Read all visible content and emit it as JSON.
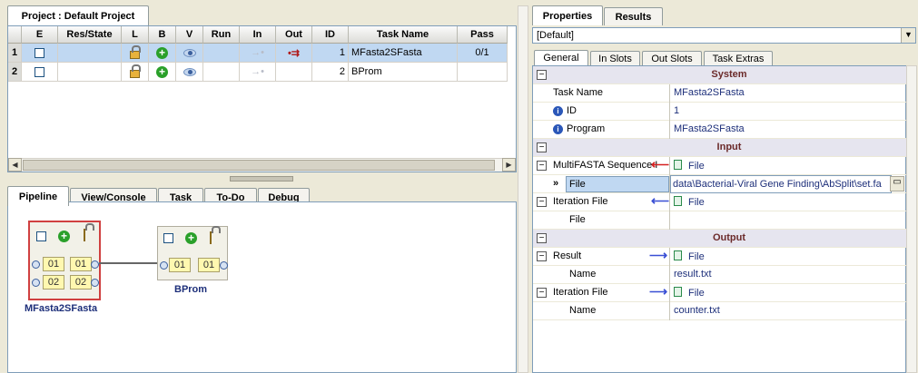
{
  "project_tab": "Project : Default Project",
  "grid": {
    "headers": [
      "E",
      "Res/State",
      "L",
      "B",
      "V",
      "Run",
      "In",
      "Out",
      "ID",
      "Task Name",
      "Pass"
    ],
    "rows": [
      {
        "num": "1",
        "id": "1",
        "task_name": "MFasta2SFasta",
        "pass": "0/1"
      },
      {
        "num": "2",
        "id": "2",
        "task_name": "BProm",
        "pass": ""
      }
    ]
  },
  "bottom_tabs": [
    "Pipeline",
    "View/Console",
    "Task",
    "To-Do",
    "Debug"
  ],
  "pipeline": {
    "nodes": [
      {
        "label": "MFasta2SFasta",
        "ports_in": [
          "01",
          "02"
        ],
        "ports_out": [
          "01",
          "02"
        ]
      },
      {
        "label": "BProm",
        "ports_in": [
          "01"
        ],
        "ports_out": [
          "01"
        ]
      }
    ]
  },
  "right_tabs": [
    "Properties",
    "Results"
  ],
  "preset": "[Default]",
  "prop_tabs": [
    "General",
    "In Slots",
    "Out Slots",
    "Task Extras"
  ],
  "props": {
    "system": {
      "title": "System",
      "task_name_key": "Task Name",
      "task_name": "MFasta2SFasta",
      "id_key": "ID",
      "id": "1",
      "program_key": "Program",
      "program": "MFasta2SFasta"
    },
    "input": {
      "title": "Input",
      "multi_key": "MultiFASTA Sequence I",
      "multi_val": "File",
      "file_key": "File",
      "file_val": "data\\Bacterial-Viral Gene Finding\\AbSplit\\set.fa",
      "iter_key": "Iteration File",
      "iter_val": "File",
      "iter_file_key": "File"
    },
    "output": {
      "title": "Output",
      "result_key": "Result",
      "result_val": "File",
      "result_name_key": "Name",
      "result_name": "result.txt",
      "iter_key": "Iteration File",
      "iter_val": "File",
      "iter_name_key": "Name",
      "iter_name": "counter.txt"
    }
  },
  "colors": {
    "selected_row": "#c0d8f2",
    "group_title": "#6b2a2a",
    "value_text": "#1d2f7a",
    "accent_red": "#d42020"
  }
}
